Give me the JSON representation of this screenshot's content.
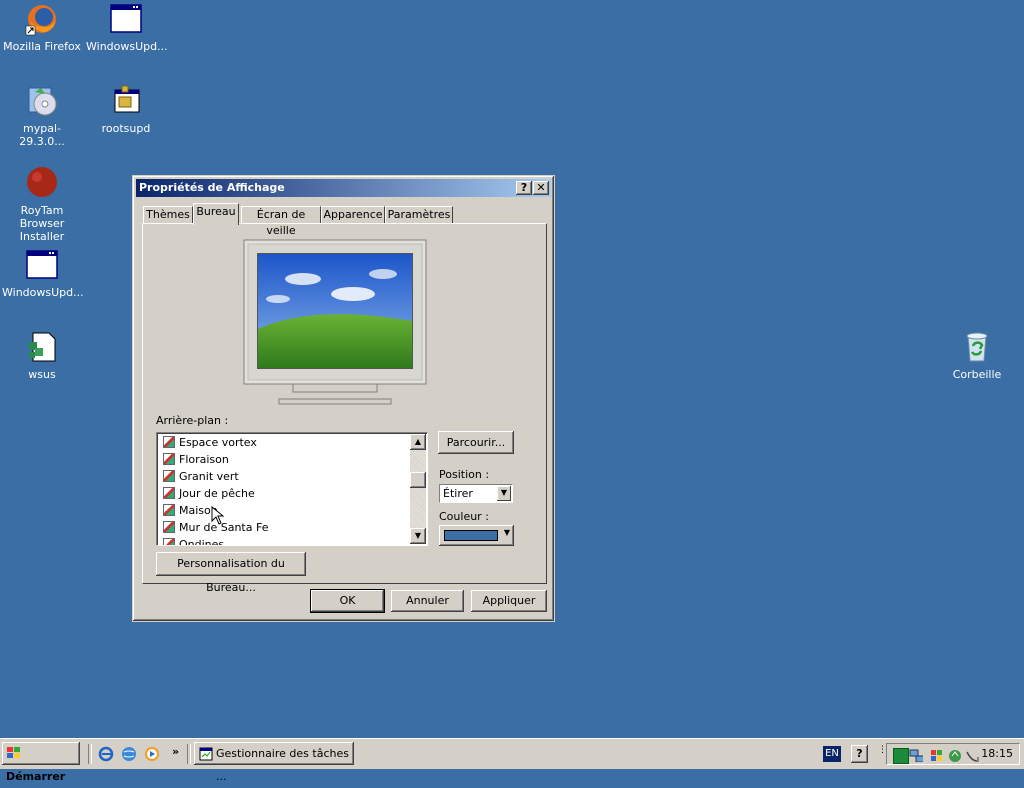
{
  "desktop": {
    "icons": [
      {
        "label": "Mozilla Firefox"
      },
      {
        "label": "WindowsUpd..."
      },
      {
        "label": "mypal-29.3.0..."
      },
      {
        "label": "rootsupd"
      },
      {
        "label": "RoyTam Browser Installer"
      },
      {
        "label": "WindowsUpd..."
      },
      {
        "label": "wsus"
      },
      {
        "label": "Corbeille"
      }
    ]
  },
  "dialog": {
    "title": "Propriétés de Affichage",
    "help_label": "?",
    "close_label": "✕",
    "tabs": [
      "Thèmes",
      "Bureau",
      "Écran de veille",
      "Apparence",
      "Paramètres"
    ],
    "active_tab": "Bureau",
    "background_label": "Arrière-plan :",
    "background_list": [
      "Espace vortex",
      "Floraison",
      "Granit vert",
      "Jour de pêche",
      "Maison",
      "Mur de Santa Fe",
      "Ondines"
    ],
    "browse_label": "Parcourir...",
    "position_label": "Position :",
    "position_value": "Étirer",
    "color_label": "Couleur :",
    "color_value": "#3a6ea5",
    "customize_label": "Personnalisation du Bureau...",
    "ok_label": "OK",
    "cancel_label": "Annuler",
    "apply_label": "Appliquer"
  },
  "taskbar": {
    "start_label": "Démarrer",
    "quicklaunch_more": "»",
    "task_label": "Gestionnaire des tâches ...",
    "language": "EN",
    "help_label": "?",
    "clock": "18:15"
  },
  "colors": {
    "desktop": "#3a6ea5",
    "title_start": "#0a246a",
    "title_end": "#a6caf0",
    "face": "#d4d0c8"
  }
}
